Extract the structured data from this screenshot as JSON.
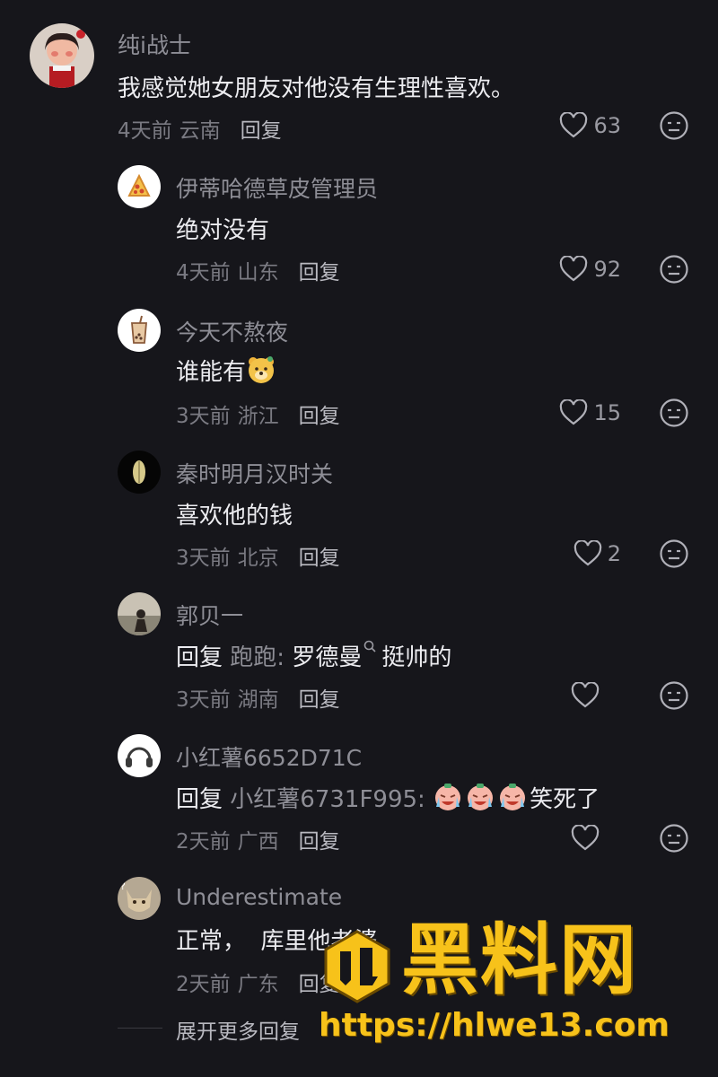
{
  "comments": [
    {
      "username": "纯ⅰ战士",
      "text": "我感觉她女朋友对他没有生理性喜欢。",
      "time": "4天前",
      "location": "云南",
      "reply_label": "回复",
      "likes": "63",
      "avatar": "girl-portrait"
    },
    {
      "username": "伊蒂哈德草皮管理员",
      "text": "绝对没有",
      "time": "4天前",
      "location": "山东",
      "reply_label": "回复",
      "likes": "92",
      "avatar": "pizza-icon"
    },
    {
      "username": "今天不熬夜",
      "text": "谁能有",
      "time": "3天前",
      "location": "浙江",
      "reply_label": "回复",
      "likes": "15",
      "avatar": "milk-tea-icon",
      "emoji": "bear-face-emoji"
    },
    {
      "username": "秦时明月汉时关",
      "text": "喜欢他的钱",
      "time": "3天前",
      "location": "北京",
      "reply_label": "回复",
      "likes": "2",
      "avatar": "glowing-leaf-icon"
    },
    {
      "username": "郭贝一",
      "reply_prefix": "回复",
      "reply_to": "跑跑:",
      "text": "罗德曼",
      "text_after": "挺帅的",
      "time": "3天前",
      "location": "湖南",
      "reply_label": "回复",
      "likes": "",
      "avatar": "beach-photo"
    },
    {
      "username": "小红薯6652D71C",
      "reply_prefix": "回复",
      "reply_to": "小红薯6731F995:",
      "text": "笑死了",
      "time": "2天前",
      "location": "广西",
      "reply_label": "回复",
      "likes": "",
      "avatar": "headphones-icon",
      "emoji": "crying-laughing-emoji"
    },
    {
      "username": "Underestimate",
      "text": "正常，  库里他老婆",
      "time": "2天前",
      "location": "广东",
      "reply_label": "回复",
      "likes": "",
      "avatar": "cat-photo"
    }
  ],
  "expand_label": "展开更多回复",
  "watermark": {
    "title": "黑料网",
    "url": "https://hlwe13.com"
  },
  "colors": {
    "background": "#16161b",
    "text": "#ececf0",
    "secondary": "#8e8e96",
    "watermark": "#f7c21a"
  }
}
